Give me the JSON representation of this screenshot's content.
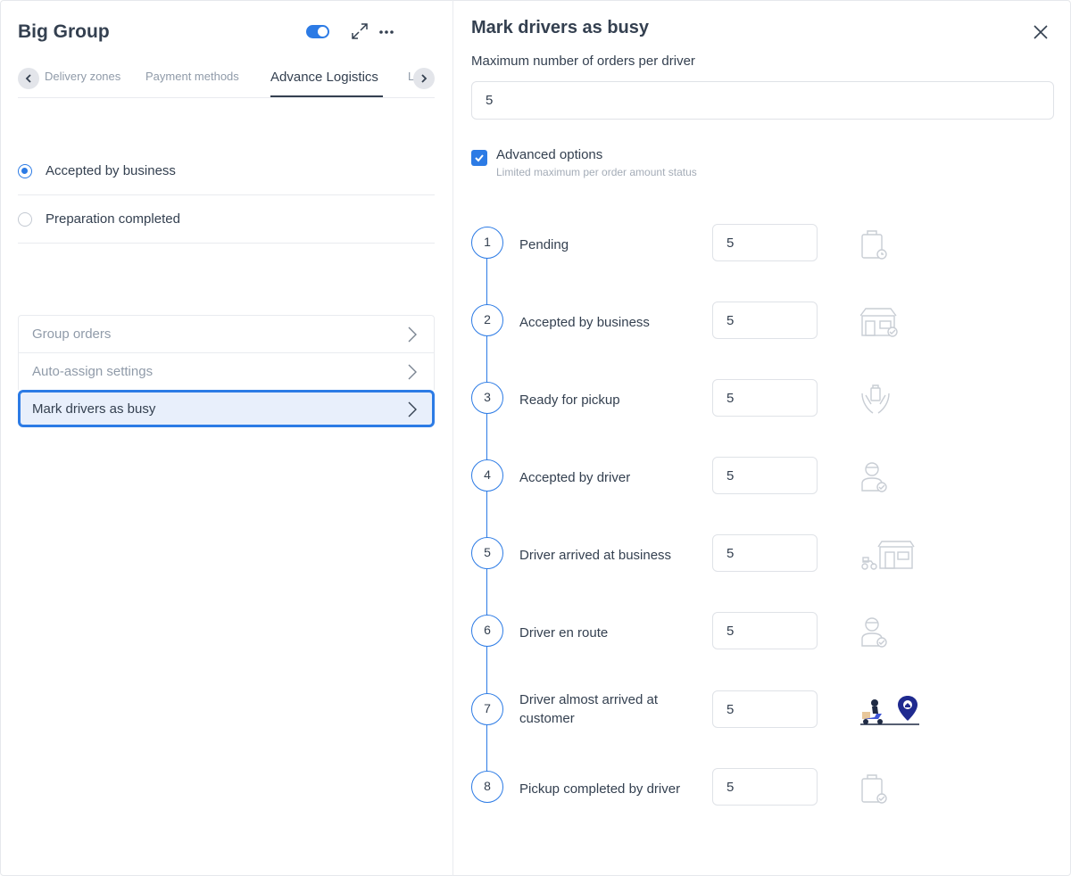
{
  "left": {
    "title": "Big Group",
    "tabs": [
      "Delivery zones",
      "Payment methods",
      "Advance Logistics",
      "L"
    ],
    "radios": [
      {
        "label": "Accepted by business",
        "checked": true
      },
      {
        "label": "Preparation completed",
        "checked": false
      }
    ],
    "menu": [
      {
        "label": "Group orders"
      },
      {
        "label": "Auto-assign settings"
      },
      {
        "label": "Mark drivers as busy",
        "selected": true
      }
    ]
  },
  "right": {
    "title": "Mark drivers as busy",
    "max_label": "Maximum number of orders per driver",
    "max_value": "5",
    "advanced": {
      "label": "Advanced options",
      "sub": "Limited maximum per order amount status",
      "checked": true
    },
    "steps": [
      {
        "num": "1",
        "label": "Pending",
        "value": "5",
        "icon": "pending-bag-icon"
      },
      {
        "num": "2",
        "label": "Accepted by business",
        "value": "5",
        "icon": "store-check-icon"
      },
      {
        "num": "3",
        "label": "Ready for pickup",
        "value": "5",
        "icon": "hands-bag-icon"
      },
      {
        "num": "4",
        "label": "Accepted by driver",
        "value": "5",
        "icon": "driver-check-icon"
      },
      {
        "num": "5",
        "label": "Driver arrived at business",
        "value": "5",
        "icon": "scooter-store-icon"
      },
      {
        "num": "6",
        "label": "Driver en route",
        "value": "5",
        "icon": "driver-check-icon"
      },
      {
        "num": "7",
        "label": "Driver almost arrived at customer",
        "value": "5",
        "icon": "scooter-location-icon"
      },
      {
        "num": "8",
        "label": "Pickup completed by driver",
        "value": "5",
        "icon": "bag-check-icon"
      }
    ]
  },
  "colors": {
    "accent": "#2c7be5",
    "text": "#344050",
    "muted": "#909ba9",
    "border": "#e9ebef"
  }
}
